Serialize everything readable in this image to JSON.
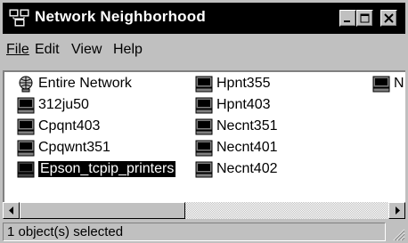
{
  "window": {
    "title": "Network Neighborhood"
  },
  "menu": [
    {
      "label": "File"
    },
    {
      "label": "Edit"
    },
    {
      "label": "View"
    },
    {
      "label": "Help"
    }
  ],
  "items": [
    {
      "label": "Entire Network",
      "icon": "globe-icon"
    },
    {
      "label": "312ju50",
      "icon": "computer-icon"
    },
    {
      "label": "Cpqnt403",
      "icon": "computer-icon"
    },
    {
      "label": "Cpqwnt351",
      "icon": "computer-icon"
    },
    {
      "label": "Epson_tcpip_printers",
      "icon": "computer-icon",
      "selected": true
    },
    {
      "label": "Hpnt355",
      "icon": "computer-icon"
    },
    {
      "label": "Hpnt403",
      "icon": "computer-icon"
    },
    {
      "label": "Necnt351",
      "icon": "computer-icon"
    },
    {
      "label": "Necnt401",
      "icon": "computer-icon"
    },
    {
      "label": "Necnt402",
      "icon": "computer-icon"
    },
    {
      "label": "N",
      "icon": "computer-icon"
    }
  ],
  "status": {
    "text": "1 object(s) selected"
  },
  "colors": {
    "title_bg": "#000000",
    "window_bg": "#c0c0c0",
    "selection": "#000000"
  }
}
